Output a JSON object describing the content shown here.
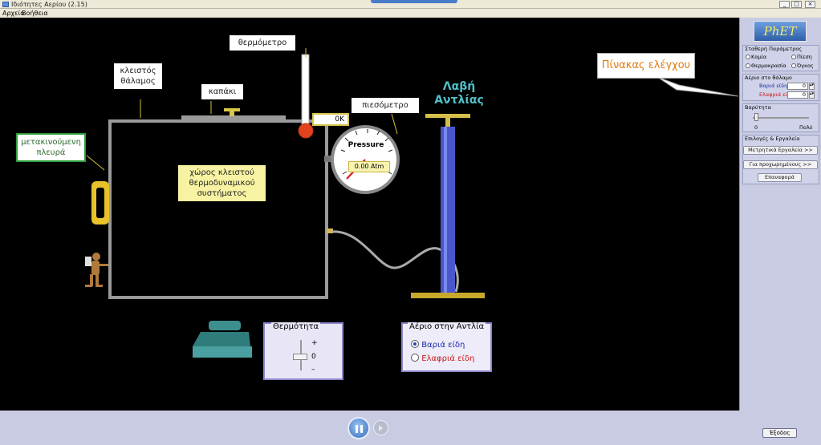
{
  "window": {
    "title": "Ιδιότητες Αερίου (2.15)",
    "menu": [
      "Αρχείο",
      "Βοήθεια"
    ]
  },
  "callouts": {
    "thermometer": "θερμόμετρο",
    "chamber": "κλειστός θάλαμος",
    "lid": "καπάκι",
    "manometer": "πιεσόμετρο",
    "moving_wall": "μετακινούμενη πλευρά",
    "system": "χώρος κλειστού θερμοδυναμικού συστήματος",
    "pump_handle": "Λαβή Αντλίας",
    "control_panel": "Πίνακας ελέγχου"
  },
  "thermometer_readout": "0K",
  "gauge": {
    "title": "Pressure",
    "value": "0.00 Atm"
  },
  "heat_control": {
    "title": "Θερμότητα",
    "plus": "+",
    "zero": "0",
    "minus": "–"
  },
  "pump_gas": {
    "title": "Αέριο στην Αντλία",
    "options": [
      "Βαριά είδη",
      "Ελαφριά είδη"
    ],
    "selected": "Βαριά είδη",
    "colors": {
      "heavy": "#1a2aa8",
      "light": "#cc1a1a"
    }
  },
  "panel": {
    "logo": "PhET",
    "constant_params_title": "Σταθερή Παράμετρος",
    "radio_none": "Καμία",
    "radio_pressure": "Πίεση",
    "radio_temperature": "Θερμοκρασία",
    "radio_volume": "Όγκος",
    "gas_in_chamber_title": "Αέριο στο θάλαμο",
    "heavy_label": "Βαριά είδη",
    "light_label": "Ελαφριά είδη",
    "heavy_count": "0",
    "light_count": "0",
    "gravity_title": "Βαρύτητα",
    "gravity_min": "0",
    "gravity_max": "Πολύ",
    "options_title": "Επιλογές & Εργαλεία",
    "measurement_tools": "Μετρητικά Εργαλεία >>",
    "advanced_options": "Για προχωρημένους >>",
    "reset": "Επαναφορά"
  },
  "footer": {
    "exit": "Έξοδος"
  }
}
